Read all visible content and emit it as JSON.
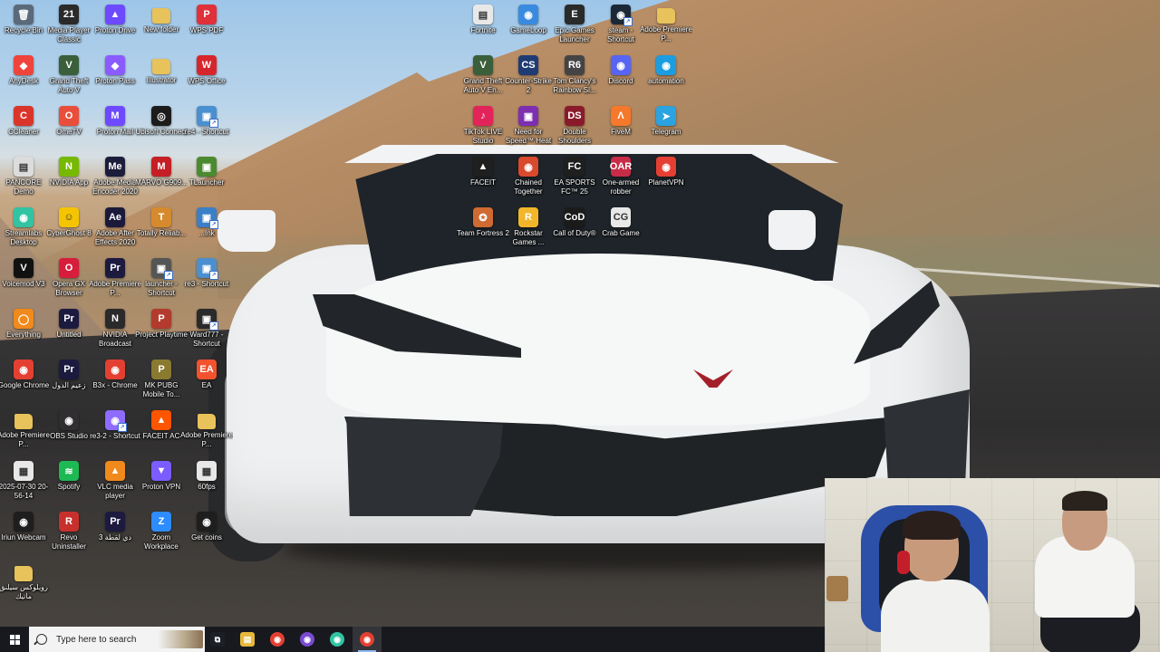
{
  "desktop": {
    "icons": [
      {
        "label": "Recycle Bin",
        "icon": "recycle-bin-icon",
        "glyph": "🗑",
        "color": "#5a6a7a",
        "shortcut": false
      },
      {
        "label": "Media Player Classic",
        "icon": "media-player-classic-icon",
        "glyph": "21",
        "color": "#2a2a2a",
        "shortcut": false
      },
      {
        "label": "Proton Drive",
        "icon": "proton-drive-icon",
        "glyph": "▲",
        "color": "#6d4aff",
        "shortcut": false
      },
      {
        "label": "New folder",
        "icon": "folder-icon",
        "glyph": "",
        "color": "#e8c25a",
        "shortcut": false
      },
      {
        "label": "WPS PDF",
        "icon": "wps-pdf-icon",
        "glyph": "P",
        "color": "#e0303a",
        "shortcut": false
      },
      {
        "label": "AnyDesk",
        "icon": "anydesk-icon",
        "glyph": "◆",
        "color": "#ef443b",
        "shortcut": false
      },
      {
        "label": "Grand Theft Auto V",
        "icon": "gta-v-icon",
        "glyph": "V",
        "color": "#3a5f3a",
        "shortcut": false
      },
      {
        "label": "Proton Pass",
        "icon": "proton-pass-icon",
        "glyph": "◆",
        "color": "#8a5cff",
        "shortcut": false
      },
      {
        "label": "Illustrator",
        "icon": "folder-icon",
        "glyph": "",
        "color": "#e8c25a",
        "shortcut": false
      },
      {
        "label": "WPS Office",
        "icon": "wps-office-icon",
        "glyph": "W",
        "color": "#d7262b",
        "shortcut": false
      },
      {
        "label": "CCleaner",
        "icon": "ccleaner-icon",
        "glyph": "C",
        "color": "#d9352b",
        "shortcut": false
      },
      {
        "label": "OmeTV",
        "icon": "ometv-icon",
        "glyph": "O",
        "color": "#e94e3a",
        "shortcut": false
      },
      {
        "label": "Proton Mail",
        "icon": "proton-mail-icon",
        "glyph": "M",
        "color": "#6d4aff",
        "shortcut": false
      },
      {
        "label": "Ubisoft Connect",
        "icon": "ubisoft-connect-icon",
        "glyph": "◎",
        "color": "#1c1c1c",
        "shortcut": false
      },
      {
        "label": "re4 - Shortcut",
        "icon": "re4-shortcut-icon",
        "glyph": "▣",
        "color": "#4a8fd0",
        "shortcut": true
      },
      {
        "label": "PANCORE Demo",
        "icon": "pancore-demo-icon",
        "glyph": "▤",
        "color": "#dcdcdc",
        "shortcut": false
      },
      {
        "label": "NVIDIA App",
        "icon": "nvidia-app-icon",
        "glyph": "N",
        "color": "#76b900",
        "shortcut": false
      },
      {
        "label": "Adobe Media Encoder 2020",
        "icon": "adobe-media-encoder-icon",
        "glyph": "Me",
        "color": "#1c1d3a",
        "shortcut": false
      },
      {
        "label": "MARVO G909...",
        "icon": "marvo-icon",
        "glyph": "M",
        "color": "#c51f25",
        "shortcut": false
      },
      {
        "label": "TLauncher",
        "icon": "tlauncher-icon",
        "glyph": "▣",
        "color": "#4b8a2f",
        "shortcut": false
      },
      {
        "label": "Streamlabs Desktop",
        "icon": "streamlabs-icon",
        "glyph": "◉",
        "color": "#31c3a2",
        "shortcut": false
      },
      {
        "label": "CyberGhost 8",
        "icon": "cyberghost-icon",
        "glyph": "☺",
        "color": "#f5c400",
        "shortcut": false
      },
      {
        "label": "Adobe After Effects 2020",
        "icon": "after-effects-icon",
        "glyph": "Ae",
        "color": "#1c1a3b",
        "shortcut": false
      },
      {
        "label": "Totally Reliab...",
        "icon": "totally-reliable-icon",
        "glyph": "T",
        "color": "#d68a2e",
        "shortcut": false
      },
      {
        "label": "...Ink",
        "icon": "shortcut-ink-icon",
        "glyph": "▣",
        "color": "#3a7fc8",
        "shortcut": true
      },
      {
        "label": "Voicemod V3",
        "icon": "voicemod-icon",
        "glyph": "V",
        "color": "#111111",
        "shortcut": false
      },
      {
        "label": "Opera GX Browser",
        "icon": "opera-gx-icon",
        "glyph": "O",
        "color": "#d81d3c",
        "shortcut": false
      },
      {
        "label": "Adobe Premiere P...",
        "icon": "premiere-pro-icon",
        "glyph": "Pr",
        "color": "#1d1a3f",
        "shortcut": false
      },
      {
        "label": "launcher - Shortcut",
        "icon": "launcher-shortcut-icon",
        "glyph": "▣",
        "color": "#555",
        "shortcut": true
      },
      {
        "label": "re3 - Shortcut",
        "icon": "re3-shortcut-icon",
        "glyph": "▣",
        "color": "#4a8fd0",
        "shortcut": true
      },
      {
        "label": "Everything",
        "icon": "everything-icon",
        "glyph": "◯",
        "color": "#f08a1c",
        "shortcut": false
      },
      {
        "label": "Untitled",
        "icon": "premiere-project-icon",
        "glyph": "Pr",
        "color": "#1d1a3f",
        "shortcut": false
      },
      {
        "label": "NVIDIA Broadcast",
        "icon": "nvidia-broadcast-icon",
        "glyph": "N",
        "color": "#2a2a2a",
        "shortcut": false
      },
      {
        "label": "Project Playtime",
        "icon": "project-playtime-icon",
        "glyph": "P",
        "color": "#b33b2e",
        "shortcut": false
      },
      {
        "label": "Ward777 - Shortcut",
        "icon": "ward777-shortcut-icon",
        "glyph": "▣",
        "color": "#2a2a2a",
        "shortcut": true
      },
      {
        "label": "Google Chrome",
        "icon": "chrome-icon",
        "glyph": "◉",
        "color": "#e44032",
        "shortcut": false
      },
      {
        "label": "زعيم الدول",
        "icon": "premiere-project-icon",
        "glyph": "Pr",
        "color": "#1d1a3f",
        "shortcut": false
      },
      {
        "label": "B3x - Chrome",
        "icon": "chrome-profile-icon",
        "glyph": "◉",
        "color": "#e44032",
        "shortcut": false
      },
      {
        "label": "MK PUBG Mobile To...",
        "icon": "pubg-mobile-icon",
        "glyph": "P",
        "color": "#8a7a30",
        "shortcut": false
      },
      {
        "label": "EA",
        "icon": "ea-icon",
        "glyph": "EA",
        "color": "#f2522e",
        "shortcut": false
      },
      {
        "label": "Adobe Premiere P...",
        "icon": "folder-icon",
        "glyph": "",
        "color": "#e8c25a",
        "shortcut": false
      },
      {
        "label": "OBS Studio",
        "icon": "obs-studio-icon",
        "glyph": "◉",
        "color": "#302e31",
        "shortcut": false
      },
      {
        "label": "re3-2 - Shortcut",
        "icon": "re3-2-shortcut-icon",
        "glyph": "◉",
        "color": "#8e6cff",
        "shortcut": true
      },
      {
        "label": "FACEIT AC",
        "icon": "faceit-ac-icon",
        "glyph": "▲",
        "color": "#ff5500",
        "shortcut": false
      },
      {
        "label": "Adobe Premiere P...",
        "icon": "folder-icon",
        "glyph": "",
        "color": "#e8c25a",
        "shortcut": false
      },
      {
        "label": "2025-07-30 20-56-14",
        "icon": "video-file-icon",
        "glyph": "▦",
        "color": "#e8e8e8",
        "shortcut": false
      },
      {
        "label": "Spotify",
        "icon": "spotify-icon",
        "glyph": "≋",
        "color": "#1db954",
        "shortcut": false
      },
      {
        "label": "VLC media player",
        "icon": "vlc-icon",
        "glyph": "▲",
        "color": "#f08a1c",
        "shortcut": false
      },
      {
        "label": "Proton VPN",
        "icon": "proton-vpn-icon",
        "glyph": "▼",
        "color": "#7b5cff",
        "shortcut": false
      },
      {
        "label": "60fps",
        "icon": "video-file-icon",
        "glyph": "▦",
        "color": "#e8e8e8",
        "shortcut": false
      },
      {
        "label": "Iriun Webcam",
        "icon": "iriun-webcam-icon",
        "glyph": "◉",
        "color": "#1e1e1e",
        "shortcut": false
      },
      {
        "label": "Revo Uninstaller",
        "icon": "revo-uninstaller-icon",
        "glyph": "R",
        "color": "#c7302c",
        "shortcut": false
      },
      {
        "label": "دي لقطة 3",
        "icon": "premiere-project-icon",
        "glyph": "Pr",
        "color": "#1d1a3f",
        "shortcut": false
      },
      {
        "label": "Zoom Workplace",
        "icon": "zoom-icon",
        "glyph": "Z",
        "color": "#2d8cff",
        "shortcut": false
      },
      {
        "label": "Get coins",
        "icon": "get-coins-icon",
        "glyph": "◉",
        "color": "#1e1e1e",
        "shortcut": false
      },
      {
        "label": "روبلوكس سيلنق ماتيك",
        "icon": "folder-icon",
        "glyph": "",
        "color": "#e8c25a",
        "shortcut": false
      },
      {
        "label": "Fortnite",
        "icon": "fortnite-icon",
        "glyph": "▤",
        "color": "#e8e8e8",
        "shortcut": false
      },
      {
        "label": "GameLoop",
        "icon": "gameloop-icon",
        "glyph": "◉",
        "color": "#3a8be0",
        "shortcut": false
      },
      {
        "label": "Epic Games Launcher",
        "icon": "epic-games-icon",
        "glyph": "E",
        "color": "#2a2a2a",
        "shortcut": false
      },
      {
        "label": "steam - Shortcut",
        "icon": "steam-icon",
        "glyph": "◉",
        "color": "#1b2838",
        "shortcut": true
      },
      {
        "label": "Adobe Premiere P...",
        "icon": "folder-icon",
        "glyph": "",
        "color": "#e8c25a",
        "shortcut": false
      },
      {
        "label": "Grand Theft Auto V En...",
        "icon": "gta-v-enhanced-icon",
        "glyph": "V",
        "color": "#3a5f3a",
        "shortcut": false
      },
      {
        "label": "Counter-Strike 2",
        "icon": "counter-strike-icon",
        "glyph": "CS",
        "color": "#1f3b73",
        "shortcut": false
      },
      {
        "label": "Tom Clancy's Rainbow Si...",
        "icon": "rainbow-six-icon",
        "glyph": "R6",
        "color": "#444",
        "shortcut": false
      },
      {
        "label": "Discord",
        "icon": "discord-icon",
        "glyph": "◉",
        "color": "#5865f2",
        "shortcut": false
      },
      {
        "label": "automation",
        "icon": "edge-icon",
        "glyph": "◉",
        "color": "#1b9de2",
        "shortcut": false
      },
      {
        "label": "TikTok LIVE Studio",
        "icon": "tiktok-live-studio-icon",
        "glyph": "♪",
        "color": "#e3245a",
        "shortcut": false
      },
      {
        "label": "Need for Speed™ Heat",
        "icon": "need-for-speed-icon",
        "glyph": "▣",
        "color": "#7d2fb0",
        "shortcut": false
      },
      {
        "label": "Double Shoulders",
        "icon": "double-shoulders-icon",
        "glyph": "DS",
        "color": "#8a1a2a",
        "shortcut": false
      },
      {
        "label": "FiveM",
        "icon": "fivem-icon",
        "glyph": "Λ",
        "color": "#f5782b",
        "shortcut": false
      },
      {
        "label": "Telegram",
        "icon": "telegram-icon",
        "glyph": "➤",
        "color": "#2aa3e0",
        "shortcut": false
      },
      {
        "label": "FACEIT",
        "icon": "faceit-icon",
        "glyph": "▲",
        "color": "#1f1f1f",
        "shortcut": false
      },
      {
        "label": "Chained Together",
        "icon": "chained-together-icon",
        "glyph": "◉",
        "color": "#d9492e",
        "shortcut": false
      },
      {
        "label": "EA SPORTS FC™ 25",
        "icon": "ea-sports-fc-icon",
        "glyph": "FC",
        "color": "#1f1f1f",
        "shortcut": false
      },
      {
        "label": "One-armed robber",
        "icon": "one-armed-robber-icon",
        "glyph": "OAR",
        "color": "#c72c48",
        "shortcut": false
      },
      {
        "label": "PlanetVPN",
        "icon": "planetvpn-icon",
        "glyph": "◉",
        "color": "#e43f32",
        "shortcut": false
      },
      {
        "label": "Team Fortress 2",
        "icon": "team-fortress-2-icon",
        "glyph": "✪",
        "color": "#cf6a32",
        "shortcut": false
      },
      {
        "label": "Rockstar Games ...",
        "icon": "rockstar-games-icon",
        "glyph": "R",
        "color": "#f2b62a",
        "shortcut": false
      },
      {
        "label": "Call of Duty®",
        "icon": "call-of-duty-icon",
        "glyph": "CoD",
        "color": "#1b1b1b",
        "shortcut": false
      },
      {
        "label": "Crab Game",
        "icon": "crab-game-icon",
        "glyph": "CG",
        "color": "#e8e8e8",
        "shortcut": false
      }
    ]
  },
  "taskbar": {
    "search_placeholder": "Type here to search",
    "apps": [
      {
        "name": "task-view-icon",
        "glyph": "⧉",
        "color": "#1d1f26",
        "active": false
      },
      {
        "name": "file-explorer-icon",
        "glyph": "▤",
        "color": "#e8b83a",
        "active": false
      },
      {
        "name": "chrome-icon",
        "glyph": "◉",
        "color": "#e44032",
        "active": false
      },
      {
        "name": "chrome-profile-icon",
        "glyph": "◉",
        "color": "#7a4ad0",
        "active": false
      },
      {
        "name": "streamlabs-icon",
        "glyph": "◉",
        "color": "#31c3a2",
        "active": false
      },
      {
        "name": "chrome-window-icon",
        "glyph": "◉",
        "color": "#e44032",
        "active": true
      }
    ]
  },
  "colors": {
    "taskbar_bg": "#14161c",
    "search_bg": "#f3f3f3",
    "label_text": "#ffffff"
  }
}
